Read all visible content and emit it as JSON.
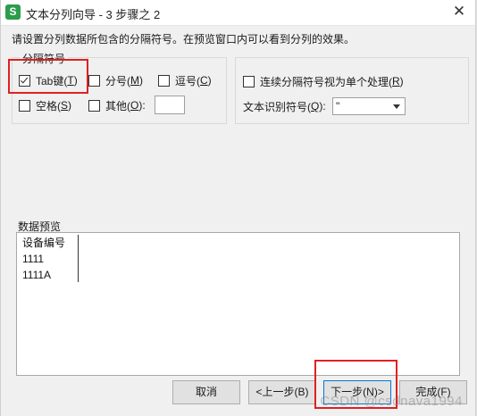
{
  "window": {
    "icon_glyph": "S",
    "title": "文本分列向导 - 3 步骤之 2",
    "close_glyph": "✕"
  },
  "instruction": "请设置分列数据所包含的分隔符号。在预览窗口内可以看到分列的效果。",
  "delimiters": {
    "label": "分隔符号",
    "tab": {
      "label": "Tab键(",
      "key": "T",
      "suffix": ")",
      "checked": true
    },
    "semicolon": {
      "label": "分号(",
      "key": "M",
      "suffix": ")",
      "checked": false
    },
    "comma": {
      "label": "逗号(",
      "key": "C",
      "suffix": ")",
      "checked": false
    },
    "space": {
      "label": "空格(",
      "key": "S",
      "suffix": ")",
      "checked": false
    },
    "other": {
      "label": "其他(",
      "key": "O",
      "suffix": "):",
      "checked": false,
      "value": ""
    }
  },
  "options": {
    "consecutive": {
      "label": "连续分隔符号视为单个处理(",
      "key": "R",
      "suffix": ")",
      "checked": false
    },
    "qualifier": {
      "label": "文本识别符号(",
      "key": "Q",
      "suffix": "):",
      "value": "\""
    }
  },
  "preview": {
    "label": "数据预览",
    "rows": [
      "设备编号",
      "1111",
      "1111A"
    ]
  },
  "buttons": {
    "cancel": "取消",
    "back": "<上一步(B)",
    "next": "下一步(N)>",
    "finish": "完成(F)"
  },
  "watermark": "CSDN @csdnava1994",
  "colors": {
    "highlight_box": "#e02020",
    "app_icon": "#2c9d4a",
    "primary_border": "#0078d7"
  }
}
